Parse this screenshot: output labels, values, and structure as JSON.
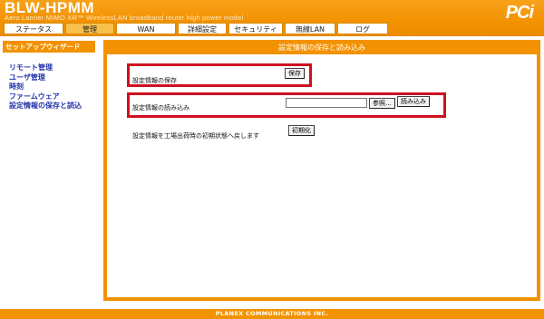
{
  "header": {
    "model": "BLW-HPMM",
    "description": "Aero Lanner MIMO XR™ WirelessLAN broadband router high power model",
    "logo": "PCi"
  },
  "nav": {
    "tabs": [
      {
        "label": "ステータス"
      },
      {
        "label": "管理"
      },
      {
        "label": "WAN"
      },
      {
        "label": "詳細設定"
      },
      {
        "label": "セキュリティ"
      },
      {
        "label": "無線LAN"
      },
      {
        "label": "ログ"
      }
    ]
  },
  "sidebar": {
    "heading": "セットアップウィザード",
    "items": [
      {
        "label": "リモート管理"
      },
      {
        "label": "ユーザ管理"
      },
      {
        "label": "時刻"
      },
      {
        "label": "ファームウェア"
      },
      {
        "label": "設定情報の保存と読込"
      }
    ]
  },
  "main": {
    "title": "設定情報の保存と読み込み",
    "save": {
      "label": "設定情報の保存",
      "button": "保存"
    },
    "load": {
      "label": "設定情報の読み込み",
      "browse_button": "参照...",
      "load_button": "読み込み",
      "file_value": ""
    },
    "reset": {
      "label": "設定情報を工場出荷時の初期状態へ戻します",
      "button": "初期化"
    }
  },
  "footer": {
    "text": "PLANEX COMMUNICATIONS INC."
  },
  "colors": {
    "accent": "#f39200",
    "highlight": "#d0101e",
    "link": "#2233aa"
  }
}
